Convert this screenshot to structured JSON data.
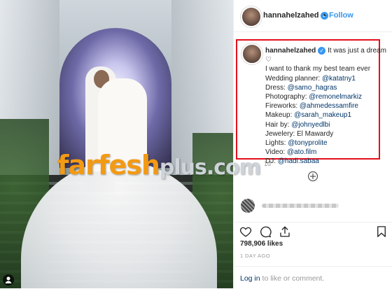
{
  "watermark": {
    "main": "farfesh",
    "plus": "plus.com"
  },
  "header": {
    "username": "hannahelzahed",
    "dot": "•",
    "follow_label": "Follow"
  },
  "caption": {
    "username": "hannahelzahed",
    "lines": [
      {
        "text": "It was just a dream"
      },
      {
        "text": "♡"
      },
      {
        "text": "I want to thank my best team ever"
      },
      {
        "label": "Wedding planner: ",
        "mention": "@katatny1"
      },
      {
        "label": "Dress: ",
        "mention": "@samo_hagras"
      },
      {
        "label": "Photography: ",
        "mention": "@remonelmarkiz"
      },
      {
        "label": "Fireworks: ",
        "mention": "@ahmedessamfire"
      },
      {
        "label": "Makeup: ",
        "mention": "@sarah_makeup1"
      },
      {
        "label": "Hair by: ",
        "mention": "@johnyedlbi"
      },
      {
        "label": "Jewelery: El Mawardy",
        "mention": ""
      },
      {
        "label": "Lights: ",
        "mention": "@tonyprolite"
      },
      {
        "label": "Video: ",
        "mention": "@ato.film"
      },
      {
        "label": "DJ: ",
        "mention": "@hadi.sabaa"
      }
    ],
    "time": "1d"
  },
  "post": {
    "likes": "798,906 likes",
    "time_ago": "1 DAY AGO"
  },
  "footer": {
    "login_label": "Log in",
    "rest": " to like or comment."
  },
  "icons": [
    "verified-badge-icon",
    "reply-icon",
    "heart-icon",
    "comment-icon",
    "share-icon",
    "bookmark-icon",
    "user-tag-icon"
  ],
  "colors": {
    "accent": "#3897f0",
    "highlight_border": "#e3101c",
    "link": "#003569",
    "watermark": "#f39a14"
  }
}
